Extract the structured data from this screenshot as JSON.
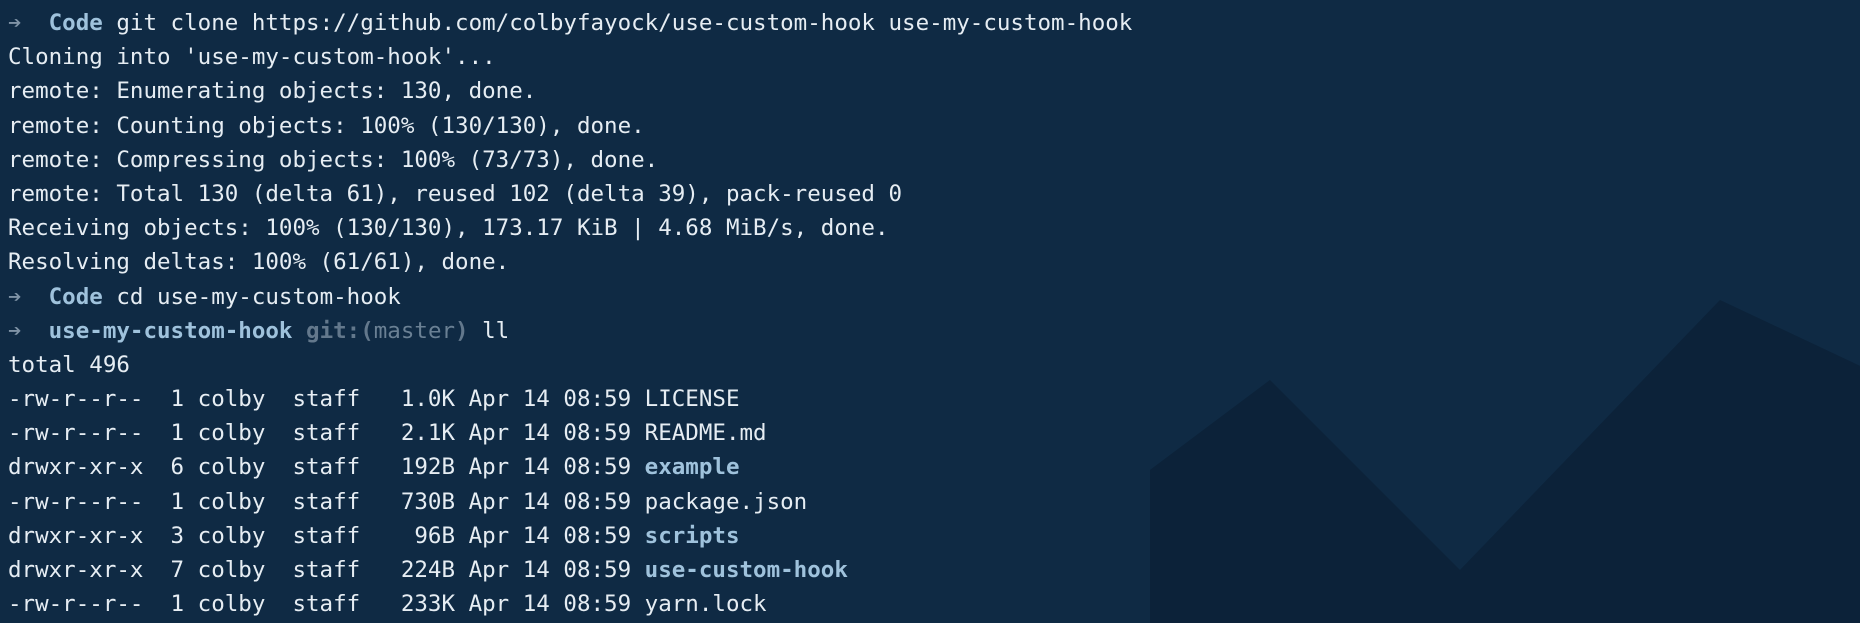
{
  "terminal": {
    "clone_prompt": {
      "arrow": "➔",
      "dir": "Code",
      "command": "git clone https://github.com/colbyfayock/use-custom-hook use-my-custom-hook"
    },
    "clone_output": [
      "Cloning into 'use-my-custom-hook'...",
      "remote: Enumerating objects: 130, done.",
      "remote: Counting objects: 100% (130/130), done.",
      "remote: Compressing objects: 100% (73/73), done.",
      "remote: Total 130 (delta 61), reused 102 (delta 39), pack-reused 0",
      "Receiving objects: 100% (130/130), 173.17 KiB | 4.68 MiB/s, done.",
      "Resolving deltas: 100% (61/61), done."
    ],
    "cd_prompt": {
      "arrow": "➔",
      "dir": "Code",
      "command": "cd use-my-custom-hook"
    },
    "ll_prompt": {
      "arrow": "➔",
      "dir": "use-my-custom-hook",
      "git_label": "git:(",
      "branch": "master",
      "git_close": ")",
      "command": "ll"
    },
    "total_line": "total 496",
    "listing": [
      {
        "meta": "-rw-r--r--  1 colby  staff   1.0K Apr 14 08:59 ",
        "name": "LICENSE",
        "is_dir": false
      },
      {
        "meta": "-rw-r--r--  1 colby  staff   2.1K Apr 14 08:59 ",
        "name": "README.md",
        "is_dir": false
      },
      {
        "meta": "drwxr-xr-x  6 colby  staff   192B Apr 14 08:59 ",
        "name": "example",
        "is_dir": true
      },
      {
        "meta": "-rw-r--r--  1 colby  staff   730B Apr 14 08:59 ",
        "name": "package.json",
        "is_dir": false
      },
      {
        "meta": "drwxr-xr-x  3 colby  staff    96B Apr 14 08:59 ",
        "name": "scripts",
        "is_dir": true
      },
      {
        "meta": "drwxr-xr-x  7 colby  staff   224B Apr 14 08:59 ",
        "name": "use-custom-hook",
        "is_dir": true
      },
      {
        "meta": "-rw-r--r--  1 colby  staff   233K Apr 14 08:59 ",
        "name": "yarn.lock",
        "is_dir": false
      }
    ]
  },
  "colors": {
    "background": "#0f2a44",
    "text": "#e6edf3",
    "accent": "#9fc2dc",
    "watermark": "#0c2239"
  },
  "icons": {
    "prompt_arrow": "arrow-right-icon",
    "watermark": "editor-logo-watermark"
  }
}
